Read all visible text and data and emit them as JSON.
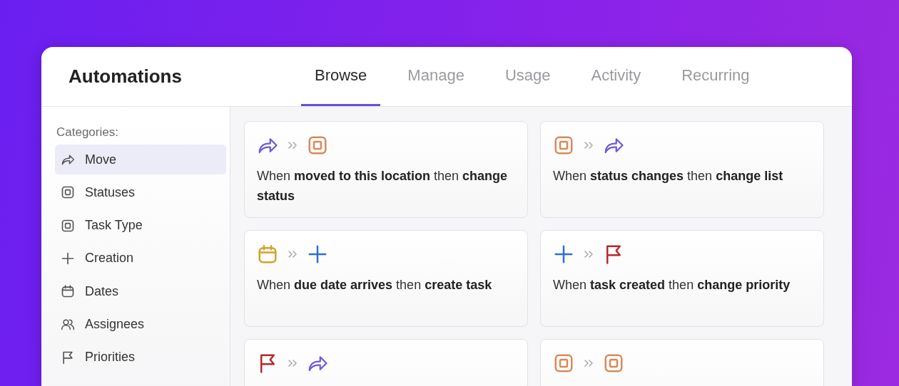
{
  "window": {
    "title": "Automations"
  },
  "tabs": [
    {
      "label": "Browse",
      "selected": true
    },
    {
      "label": "Manage",
      "selected": false
    },
    {
      "label": "Usage",
      "selected": false
    },
    {
      "label": "Activity",
      "selected": false
    },
    {
      "label": "Recurring",
      "selected": false
    }
  ],
  "sidebar": {
    "heading": "Categories:",
    "items": [
      {
        "label": "Move",
        "kind": "move",
        "selected": true
      },
      {
        "label": "Statuses",
        "kind": "status",
        "selected": false
      },
      {
        "label": "Task Type",
        "kind": "status",
        "selected": false
      },
      {
        "label": "Creation",
        "kind": "plus",
        "selected": false
      },
      {
        "label": "Dates",
        "kind": "calendar",
        "selected": false
      },
      {
        "label": "Assignees",
        "kind": "people",
        "selected": false
      },
      {
        "label": "Priorities",
        "kind": "flag",
        "selected": false
      }
    ]
  },
  "cards": [
    {
      "steps": [
        {
          "kind": "move"
        },
        {
          "kind": "status"
        }
      ],
      "text": "When **moved to this location** then **change status**"
    },
    {
      "steps": [
        {
          "kind": "status"
        },
        {
          "kind": "move"
        }
      ],
      "text": "When **status changes** then **change list**"
    },
    {
      "steps": [
        {
          "kind": "calendar"
        },
        {
          "kind": "plus"
        }
      ],
      "text": "When **due date arrives** then **create task**"
    },
    {
      "steps": [
        {
          "kind": "plus"
        },
        {
          "kind": "flag"
        }
      ],
      "text": "When **task created** then **change priority**"
    },
    {
      "steps": [
        {
          "kind": "flag"
        },
        {
          "kind": "move"
        }
      ]
    },
    {
      "steps": [
        {
          "kind": "status"
        },
        {
          "kind": "status"
        }
      ]
    }
  ]
}
